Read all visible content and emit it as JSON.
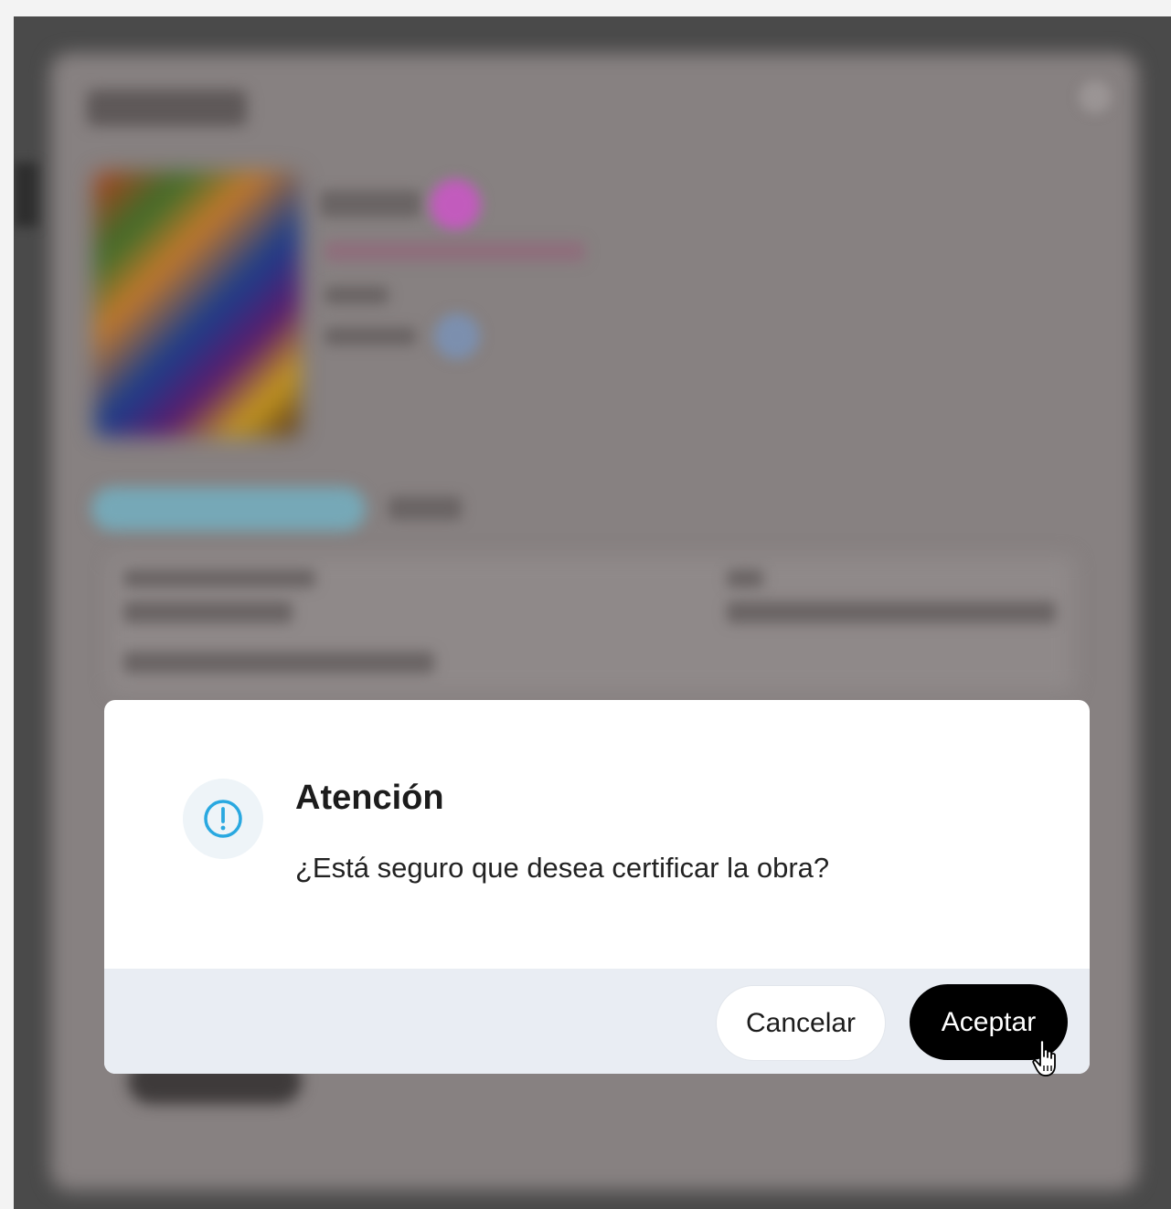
{
  "dialog": {
    "title": "Atención",
    "message": "¿Está seguro que desea certificar la obra?",
    "icon": "alert-circle-icon",
    "cancel_label": "Cancelar",
    "accept_label": "Aceptar"
  },
  "colors": {
    "accent": "#29a8e0",
    "accept_button": "#000000",
    "footer_background": "#e9edf3",
    "overlay": "#4a4a4a"
  },
  "cursor": "hand-pointer-icon"
}
